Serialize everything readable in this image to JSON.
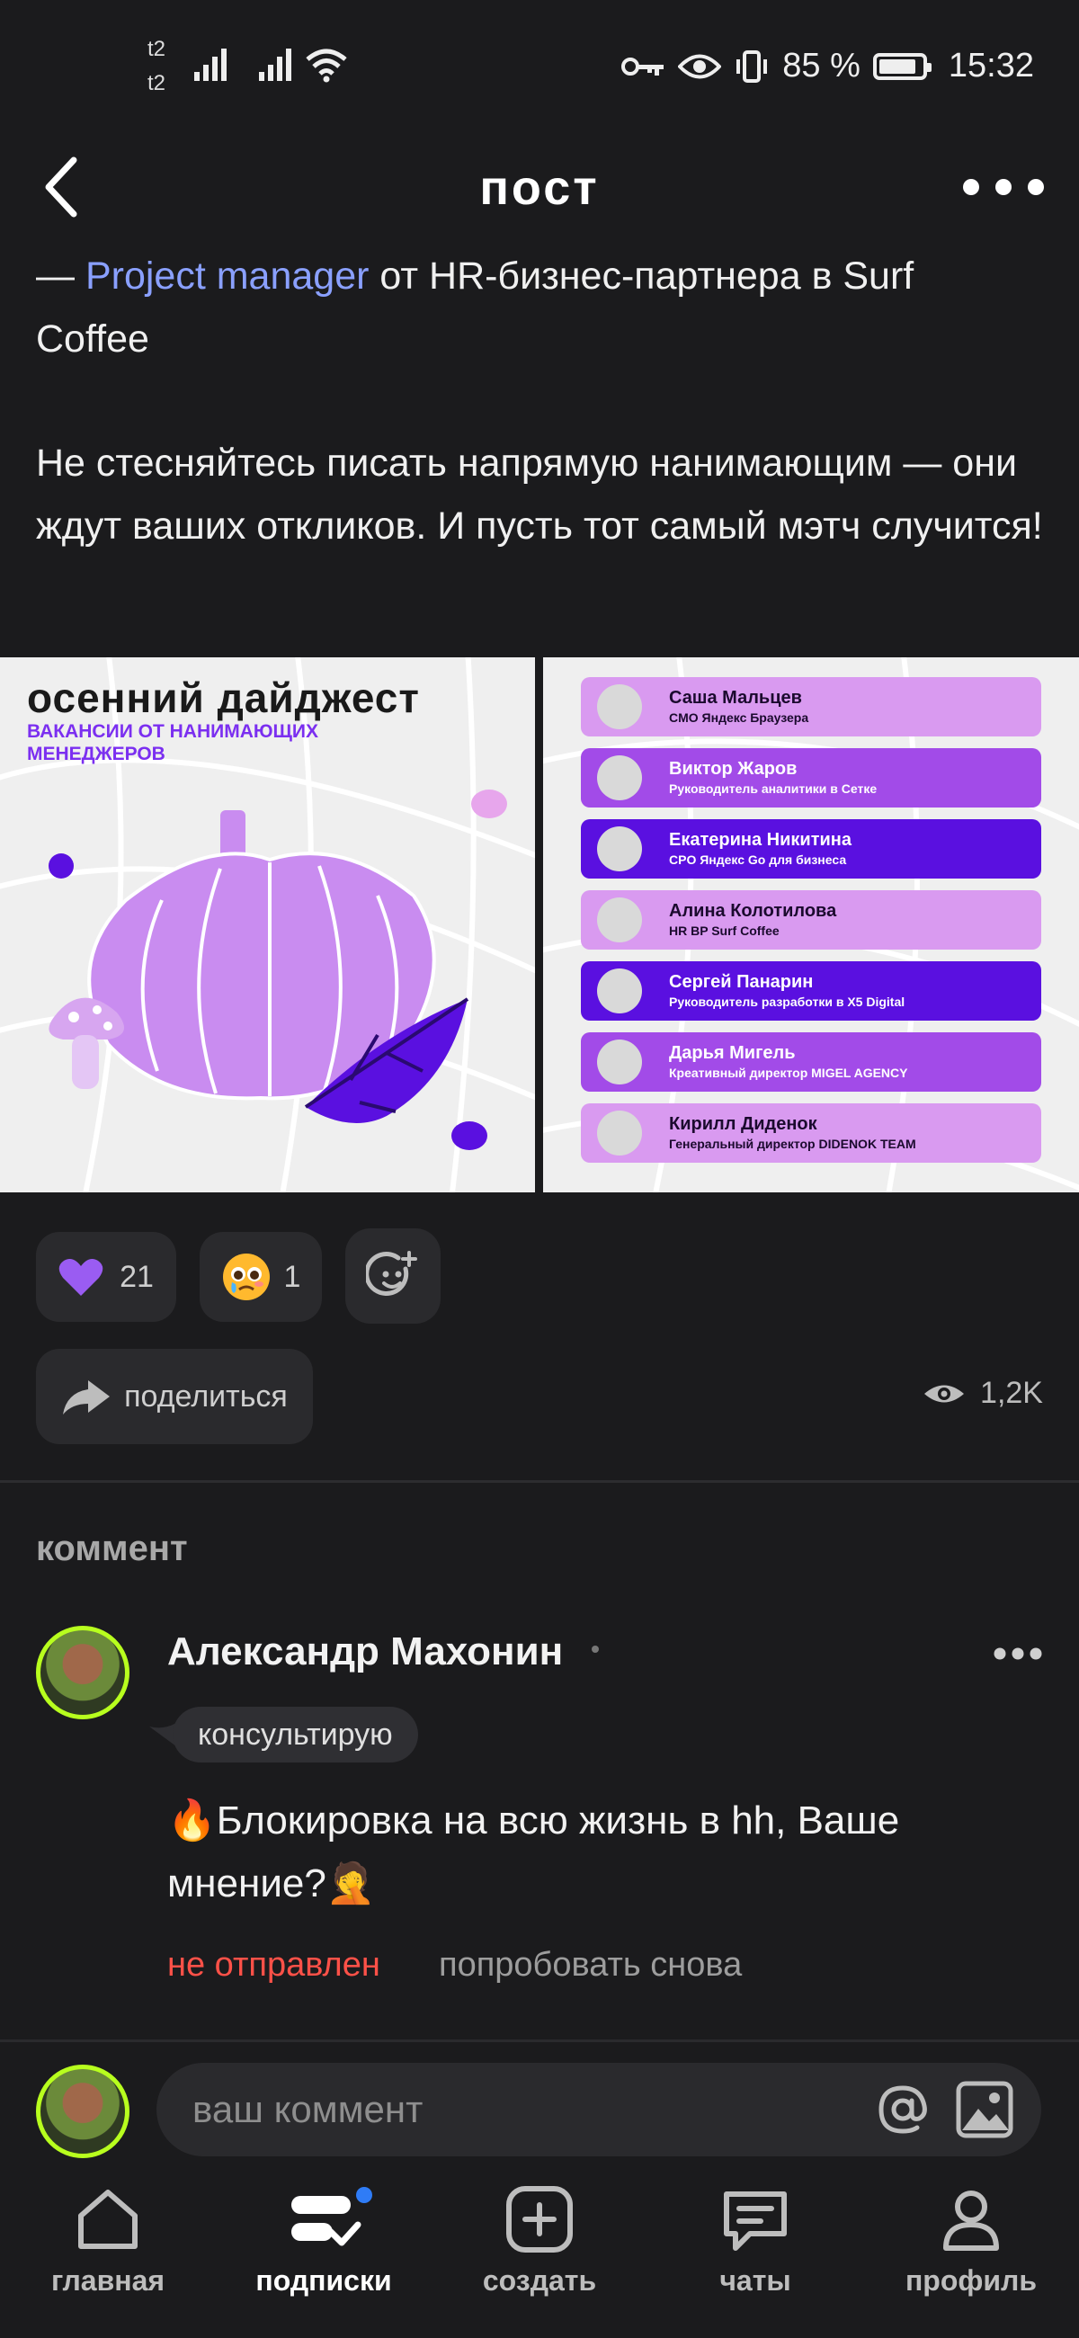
{
  "status_bar": {
    "carrier1": "t2",
    "carrier2": "t2",
    "battery": "85 %",
    "battery_level": 0.85,
    "time": "15:32"
  },
  "header": {
    "title": "пост"
  },
  "post": {
    "line1_prefix": "— ",
    "line1_link": "Project manager",
    "line1_rest": " от HR-бизнес-партнера в Surf",
    "line2": "Coffee",
    "paragraph": "Не стесняйтесь писать напрямую нанимающим — они ждут ваших откликов. И пусть тот самый мэтч случится!"
  },
  "image1": {
    "title": "осенний дайджест",
    "subtitle": "ВАКАНСИИ ОТ НАНИМАЮЩИХ МЕНЕДЖЕРОВ"
  },
  "image2": {
    "cards": [
      {
        "name": "Саша Мальцев",
        "role": "CMO Яндекс Браузера",
        "style": "light"
      },
      {
        "name": "Виктор Жаров",
        "role": "Руководитель аналитики в Сетке",
        "style": "mid"
      },
      {
        "name": "Екатерина Никитина",
        "role": "CPO Яндекс Go для бизнеса",
        "style": "dark"
      },
      {
        "name": "Алина Колотилова",
        "role": "HR BP Surf Coffee",
        "style": "light"
      },
      {
        "name": "Сергей Панарин",
        "role": "Руководитель разработки в X5 Digital",
        "style": "dark"
      },
      {
        "name": "Дарья Мигель",
        "role": "Креативный директор MIGEL AGENCY",
        "style": "mid"
      },
      {
        "name": "Кирилл Диденок",
        "role": "Генеральный директор DIDENOK TEAM",
        "style": "light"
      }
    ]
  },
  "reactions": {
    "heart_count": "21",
    "emoji_count": "1",
    "share_label": "поделиться",
    "views": "1,2K"
  },
  "comments": {
    "heading": "коммент",
    "author": "Александр Махонин",
    "tag": "консультирую",
    "text": "🔥Блокировка на всю жизнь в hh, Ваше мнение?🤦",
    "failed_label": "не отправлен",
    "retry_label": "попробовать снова"
  },
  "composer": {
    "placeholder": "ваш коммент"
  },
  "nav": {
    "home": "главная",
    "subscriptions": "подписки",
    "create": "создать",
    "chats": "чаты",
    "profile": "профиль"
  }
}
